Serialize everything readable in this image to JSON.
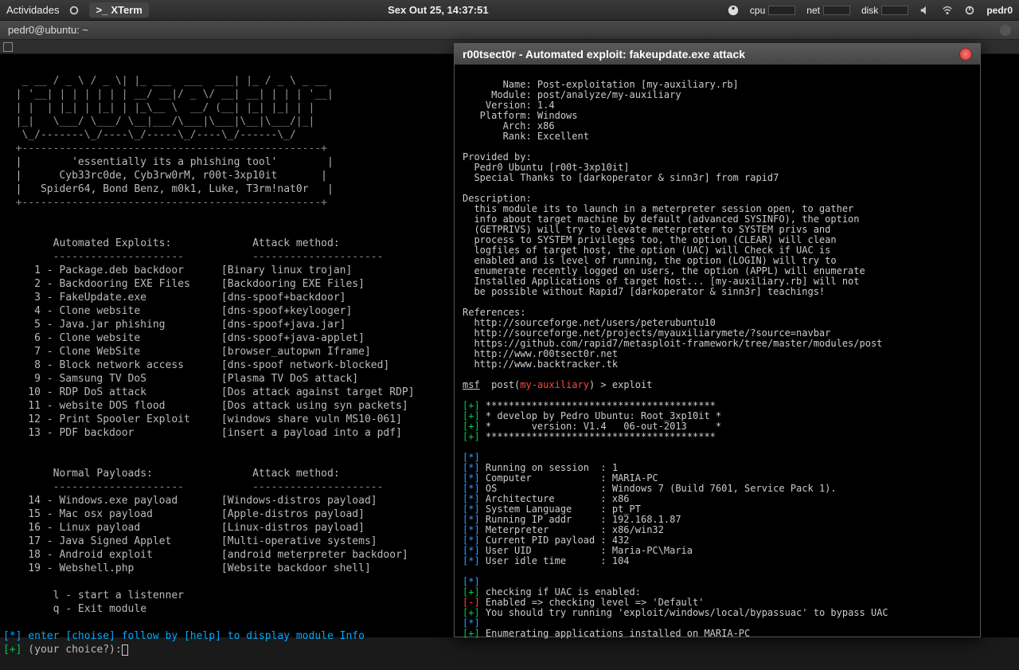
{
  "topbar": {
    "activities": "Actividades",
    "app": "XTerm",
    "clock": "Sex Out 25, 14:37:51",
    "cpu": "cpu",
    "net": "net",
    "disk": "disk",
    "user": "pedr0"
  },
  "winTitle": "pedr0@ubuntu: ~",
  "banner": {
    "tagline": "'essentially its a phishing tool'",
    "credits1": "Cyb33rc0de, Cyb3rw0rM, r00t-3xp10it",
    "credits2": "Spider64, Bond Benz, m0k1, Luke, T3rm!nat0r"
  },
  "headers": {
    "autoExploits": "Automated Exploits:",
    "normalPayloads": "Normal Payloads:",
    "attackMethod": "Attack method:"
  },
  "exploits": [
    {
      "n": " 1",
      "name": "Package.deb backdoor",
      "method": "[Binary linux trojan]"
    },
    {
      "n": " 2",
      "name": "Backdooring EXE Files",
      "method": "[Backdooring EXE Files]"
    },
    {
      "n": " 3",
      "name": "FakeUpdate.exe",
      "method": "[dns-spoof+backdoor]"
    },
    {
      "n": " 4",
      "name": "Clone website",
      "method": "[dns-spoof+keylooger]"
    },
    {
      "n": " 5",
      "name": "Java.jar phishing",
      "method": "[dns-spoof+java.jar]"
    },
    {
      "n": " 6",
      "name": "Clone website",
      "method": "[dns-spoof+java-applet]"
    },
    {
      "n": " 7",
      "name": "Clone WebSite",
      "method": "[browser_autopwn Iframe]"
    },
    {
      "n": " 8",
      "name": "Block network access",
      "method": "[dns-spoof network-blocked]"
    },
    {
      "n": " 9",
      "name": "Samsung TV DoS",
      "method": "[Plasma TV DoS attack]"
    },
    {
      "n": "10",
      "name": "RDP DoS attack",
      "method": "[Dos attack against target RDP]"
    },
    {
      "n": "11",
      "name": "website DOS flood",
      "method": "[Dos attack using syn packets]"
    },
    {
      "n": "12",
      "name": "Print Spooler Exploit",
      "method": "[windows share vuln MS10-061]"
    },
    {
      "n": "13",
      "name": "PDF backdoor",
      "method": "[insert a payload into a pdf]"
    }
  ],
  "payloads": [
    {
      "n": "14",
      "name": "Windows.exe payload",
      "method": "[Windows-distros payload]"
    },
    {
      "n": "15",
      "name": "Mac osx payload",
      "method": "[Apple-distros payload]"
    },
    {
      "n": "16",
      "name": "Linux payload",
      "method": "[Linux-distros payload]"
    },
    {
      "n": "17",
      "name": "Java Signed Applet",
      "method": "[Multi-operative systems]"
    },
    {
      "n": "18",
      "name": "Android exploit",
      "method": "[android meterpreter backdoor]"
    },
    {
      "n": "19",
      "name": "Webshell.php",
      "method": "[Website backdoor shell]"
    }
  ],
  "extras": {
    "l": "l - start a listenner",
    "q": "q - Exit module"
  },
  "prompt": {
    "hint": "[*] enter [choise] follow by [help] to display module Info",
    "line": "[+] (your choice?):"
  },
  "dialog": {
    "title": "r00tsect0r - Automated exploit: fakeupdate.exe attack",
    "info": {
      "Name": "Post-exploitation [my-auxiliary.rb]",
      "Module": "post/analyze/my-auxiliary",
      "Version": "1.4",
      "Platform": "Windows",
      "Arch": "x86",
      "Rank": "Excellent"
    },
    "providedBy": "Provided by:",
    "providers": [
      "Pedr0 Ubuntu [r00t-3xp10it]",
      "Special Thanks to [darkoperator & sinn3r] from rapid7"
    ],
    "descHeader": "Description:",
    "description": "this module its to launch in a meterpreter session open, to gather\ninfo about target machine by default (advanced SYSINFO), the option\n(GETPRIVS) will try to elevate meterpreter to SYSTEM privs and\nprocess to SYSTEM privileges too, the option (CLEAR) will clean\nlogfiles of target host, the option (UAC) will Check if UAC is\nenabled and is level of running, the option (LOGIN) will try to\nenumerate recently logged on users, the option (APPL) will enumerate\nInstalled Applications of target host... [my-auxiliary.rb] will not\nbe possible without Rapid7 [darkoperator & sinn3r] teachings!",
    "refsHeader": "References:",
    "refs": [
      "http://sourceforge.net/users/peterubuntu10",
      "http://sourceforge.net/projects/myauxiliarymete/?source=navbar",
      "https://github.com/rapid7/metasploit-framework/tree/master/modules/post",
      "http://www.r00tsect0r.net",
      "http://www.backtracker.tk"
    ],
    "msfPrompt": {
      "msf": "msf",
      "post": "post(",
      "mod": "my-auxiliary",
      "close": ") > ",
      "cmd": "exploit"
    },
    "runHeader": [
      "****************************************",
      "* develop by Pedro Ubuntu: Root_3xp10it *",
      "*       version: V1.4   06-out-2013     *",
      "****************************************"
    ],
    "sysinfo": [
      {
        "k": "Running on session",
        "v": "1"
      },
      {
        "k": "Computer",
        "v": "MARIA-PC"
      },
      {
        "k": "OS",
        "v": "Windows 7 (Build 7601, Service Pack 1)."
      },
      {
        "k": "Architecture",
        "v": "x86"
      },
      {
        "k": "System Language",
        "v": "pt_PT"
      },
      {
        "k": "Running IP addr",
        "v": "192.168.1.87"
      },
      {
        "k": "Meterpreter",
        "v": "x86/win32"
      },
      {
        "k": "Current PID payload",
        "v": "432"
      },
      {
        "k": "User UID",
        "v": "Maria-PC\\Maria"
      },
      {
        "k": "User idle time",
        "v": "104"
      }
    ],
    "uacCheck": "checking if UAC is enabled:",
    "uacEnabled": "Enabled => checking level => 'Default'",
    "uacBypass": "You should try running 'exploit/windows/local/bypassuac' to bypass UAC",
    "enumApps": "Enumerating applications installed on MARIA-PC"
  }
}
